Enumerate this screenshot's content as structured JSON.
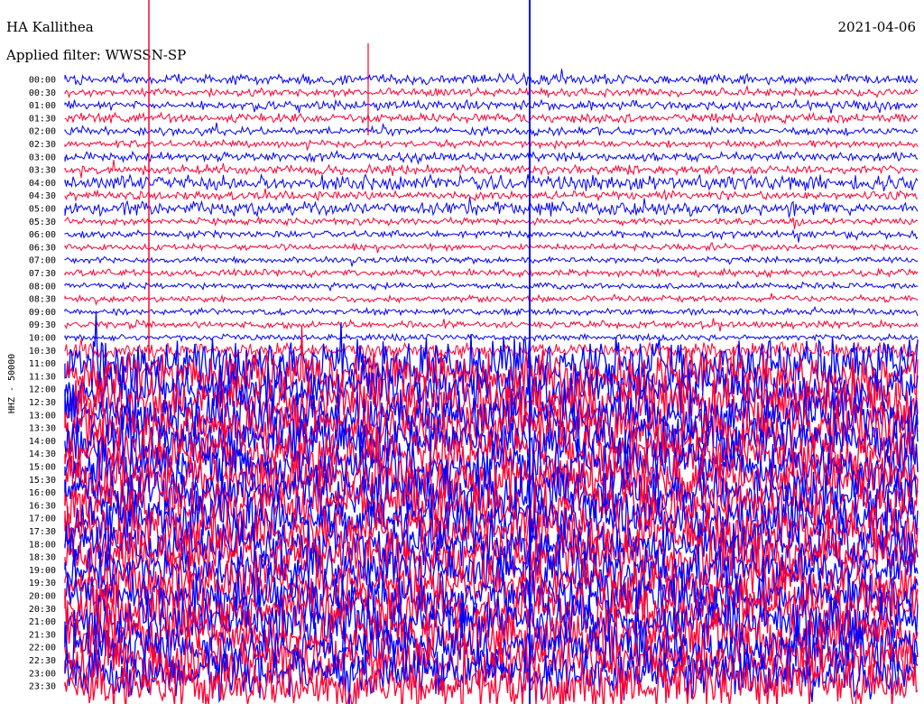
{
  "header": {
    "station": "HA Kallithea",
    "date": "2021-04-06",
    "filter_label": "Applied filter: WWSSN-SP"
  },
  "chart_data": {
    "type": "line",
    "title": "HA Kallithea",
    "date": "2021-04-06",
    "filter": "WWSSN-SP",
    "ylabel": "HHZ - 50000",
    "trace_colors": [
      "#0000ff",
      "#ff0033"
    ],
    "line_times": [
      "00:00",
      "00:30",
      "01:00",
      "01:30",
      "02:00",
      "02:30",
      "03:00",
      "03:30",
      "04:00",
      "04:30",
      "05:00",
      "05:30",
      "06:00",
      "06:30",
      "07:00",
      "07:30",
      "08:00",
      "08:30",
      "09:00",
      "09:30",
      "10:00",
      "10:30",
      "11:00",
      "11:30",
      "12:00",
      "12:30",
      "13:00",
      "13:30",
      "14:00",
      "14:30",
      "15:00",
      "15:30",
      "16:00",
      "16:30",
      "17:00",
      "17:30",
      "18:00",
      "18:30",
      "19:00",
      "19:30",
      "20:00",
      "20:30",
      "21:00",
      "21:30",
      "22:00",
      "22:30",
      "23:00",
      "23:30"
    ],
    "activity_level": [
      0.35,
      0.25,
      0.3,
      0.3,
      0.25,
      0.2,
      0.3,
      0.3,
      0.6,
      0.25,
      0.5,
      0.2,
      0.2,
      0.15,
      0.15,
      0.2,
      0.15,
      0.15,
      0.15,
      0.2,
      0.15,
      0.6,
      1.0,
      1.0,
      1.0,
      1.0,
      1.0,
      1.0,
      1.0,
      1.0,
      1.0,
      1.0,
      1.0,
      1.0,
      1.0,
      1.0,
      1.0,
      1.0,
      1.0,
      1.0,
      1.0,
      1.0,
      1.0,
      1.0,
      1.0,
      1.0,
      1.0,
      1.0
    ]
  }
}
